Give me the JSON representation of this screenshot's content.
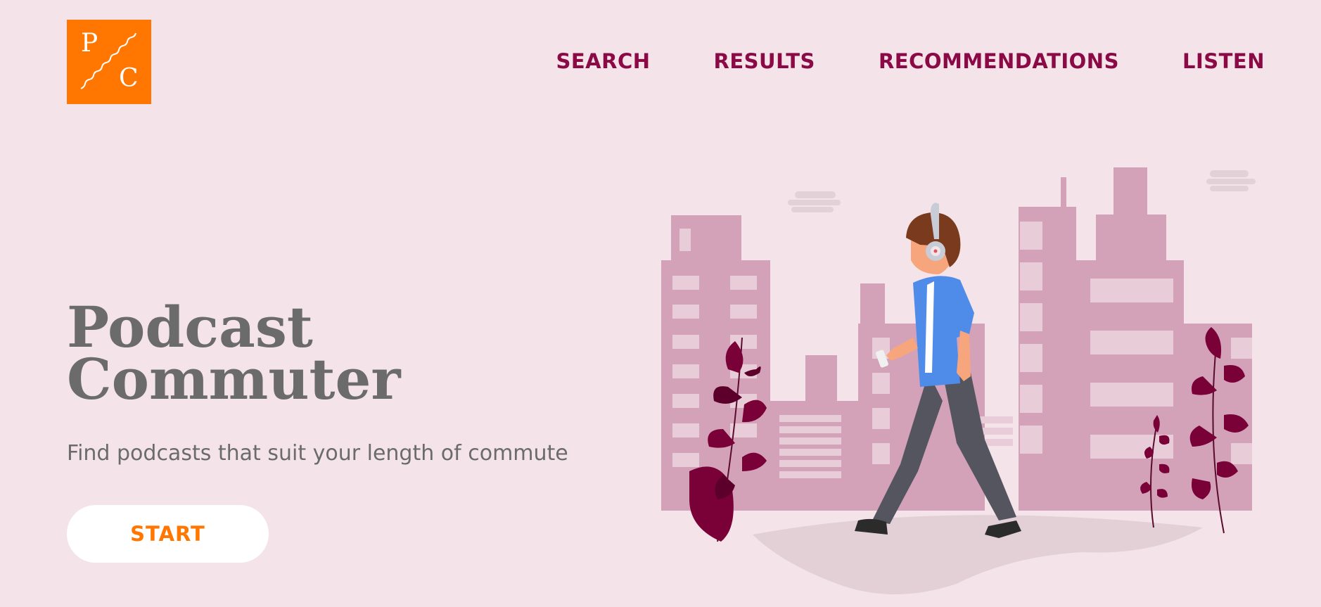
{
  "logo": {
    "letter_top": "P",
    "letter_bottom": "C",
    "color": "#ff7700"
  },
  "nav": {
    "items": [
      {
        "label": "SEARCH"
      },
      {
        "label": "RESULTS"
      },
      {
        "label": "RECOMMENDATIONS"
      },
      {
        "label": "LISTEN"
      }
    ]
  },
  "hero": {
    "title_line1": "Podcast",
    "title_line2": "Commuter",
    "subtitle": "Find podcasts that suit your length of commute",
    "start_label": "START"
  },
  "colors": {
    "background": "#f4e4e9",
    "nav_text": "#8b0a46",
    "accent": "#ff7700",
    "buildings": "#d3a2b8",
    "leaves": "#7a0038",
    "shirt": "#4f8cea"
  },
  "illustration": {
    "icon": "commuter-walking-illustration"
  }
}
